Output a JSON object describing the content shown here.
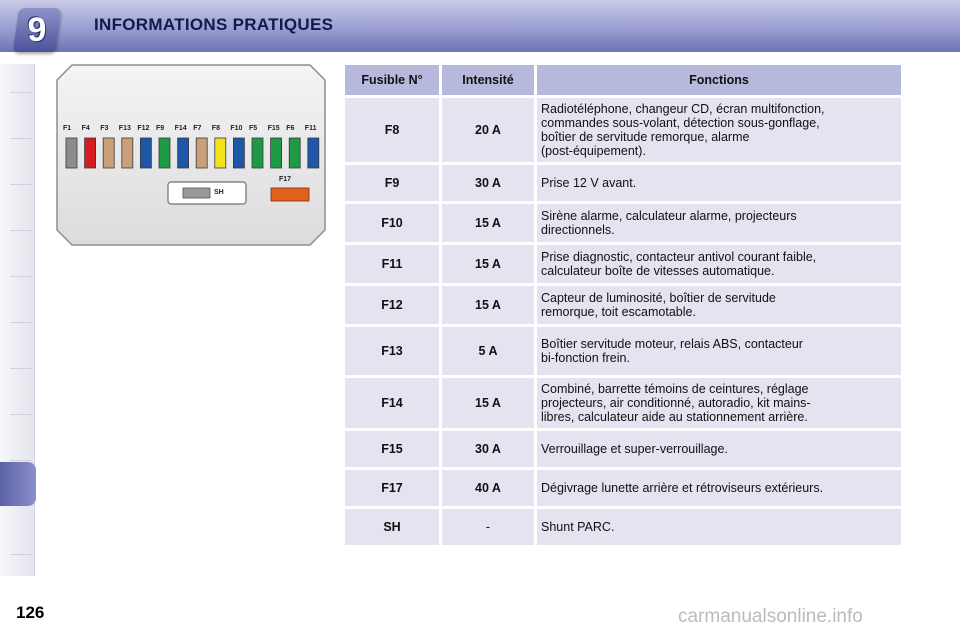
{
  "header": {
    "chapter_number": "9",
    "title": "INFORMATIONS PRATIQUES"
  },
  "diagram": {
    "fuses": [
      {
        "label": "F1",
        "color": "#8c8c8c"
      },
      {
        "label": "F4",
        "color": "#d81b22"
      },
      {
        "label": "F3",
        "color": "#c9a07a"
      },
      {
        "label": "F13",
        "color": "#c9a07a"
      },
      {
        "label": "F12",
        "color": "#1e57a8"
      },
      {
        "label": "F9",
        "color": "#1e9a45"
      },
      {
        "label": "F14",
        "color": "#1e57a8"
      },
      {
        "label": "F7",
        "color": "#c9a07a"
      },
      {
        "label": "F8",
        "color": "#f2e21a"
      },
      {
        "label": "F10",
        "color": "#1e57a8"
      },
      {
        "label": "F5",
        "color": "#1e9a45"
      },
      {
        "label": "F15",
        "color": "#1e9a45"
      },
      {
        "label": "F6",
        "color": "#1e9a45"
      },
      {
        "label": "F11",
        "color": "#1e57a8"
      }
    ],
    "shunt_label": "SH",
    "f17_label": "F17",
    "f17_color": "#e0611c"
  },
  "table": {
    "headers": [
      "Fusible N°",
      "Intensité",
      "Fonctions"
    ],
    "rows": [
      {
        "fuse": "F8",
        "amps": "20 A",
        "lines": [
          "Radiotéléphone, changeur CD, écran multifonction,",
          "commandes sous-volant, détection sous-gonflage,",
          "boîtier de servitude remorque, alarme",
          "(post-équipement)."
        ]
      },
      {
        "fuse": "F9",
        "amps": "30 A",
        "lines": [
          "Prise 12 V avant."
        ]
      },
      {
        "fuse": "F10",
        "amps": "15 A",
        "lines": [
          "Sirène alarme, calculateur alarme, projecteurs",
          "directionnels."
        ]
      },
      {
        "fuse": "F11",
        "amps": "15 A",
        "lines": [
          "Prise diagnostic, contacteur antivol courant faible,",
          "calculateur boîte de vitesses automatique."
        ]
      },
      {
        "fuse": "F12",
        "amps": "15 A",
        "lines": [
          "Capteur de luminosité, boîtier de servitude",
          "remorque, toit escamotable."
        ]
      },
      {
        "fuse": "F13",
        "amps": "5 A",
        "lines": [
          "Boîtier servitude moteur, relais ABS, contacteur",
          "bi-fonction frein."
        ]
      },
      {
        "fuse": "F14",
        "amps": "15 A",
        "lines": [
          "Combiné, barrette témoins de ceintures, réglage",
          "projecteurs, air conditionné, autoradio, kit mains-",
          "libres, calculateur aide au stationnement arrière."
        ]
      },
      {
        "fuse": "F15",
        "amps": "30 A",
        "lines": [
          "Verrouillage et super-verrouillage."
        ]
      },
      {
        "fuse": "F17",
        "amps": "40 A",
        "lines": [
          "Dégivrage lunette arrière et rétroviseurs extérieurs."
        ]
      },
      {
        "fuse": "SH",
        "amps": "-",
        "lines": [
          "Shunt PARC."
        ]
      }
    ]
  },
  "footer": {
    "page_number": "126",
    "watermark": "carmanualsonline.info"
  }
}
